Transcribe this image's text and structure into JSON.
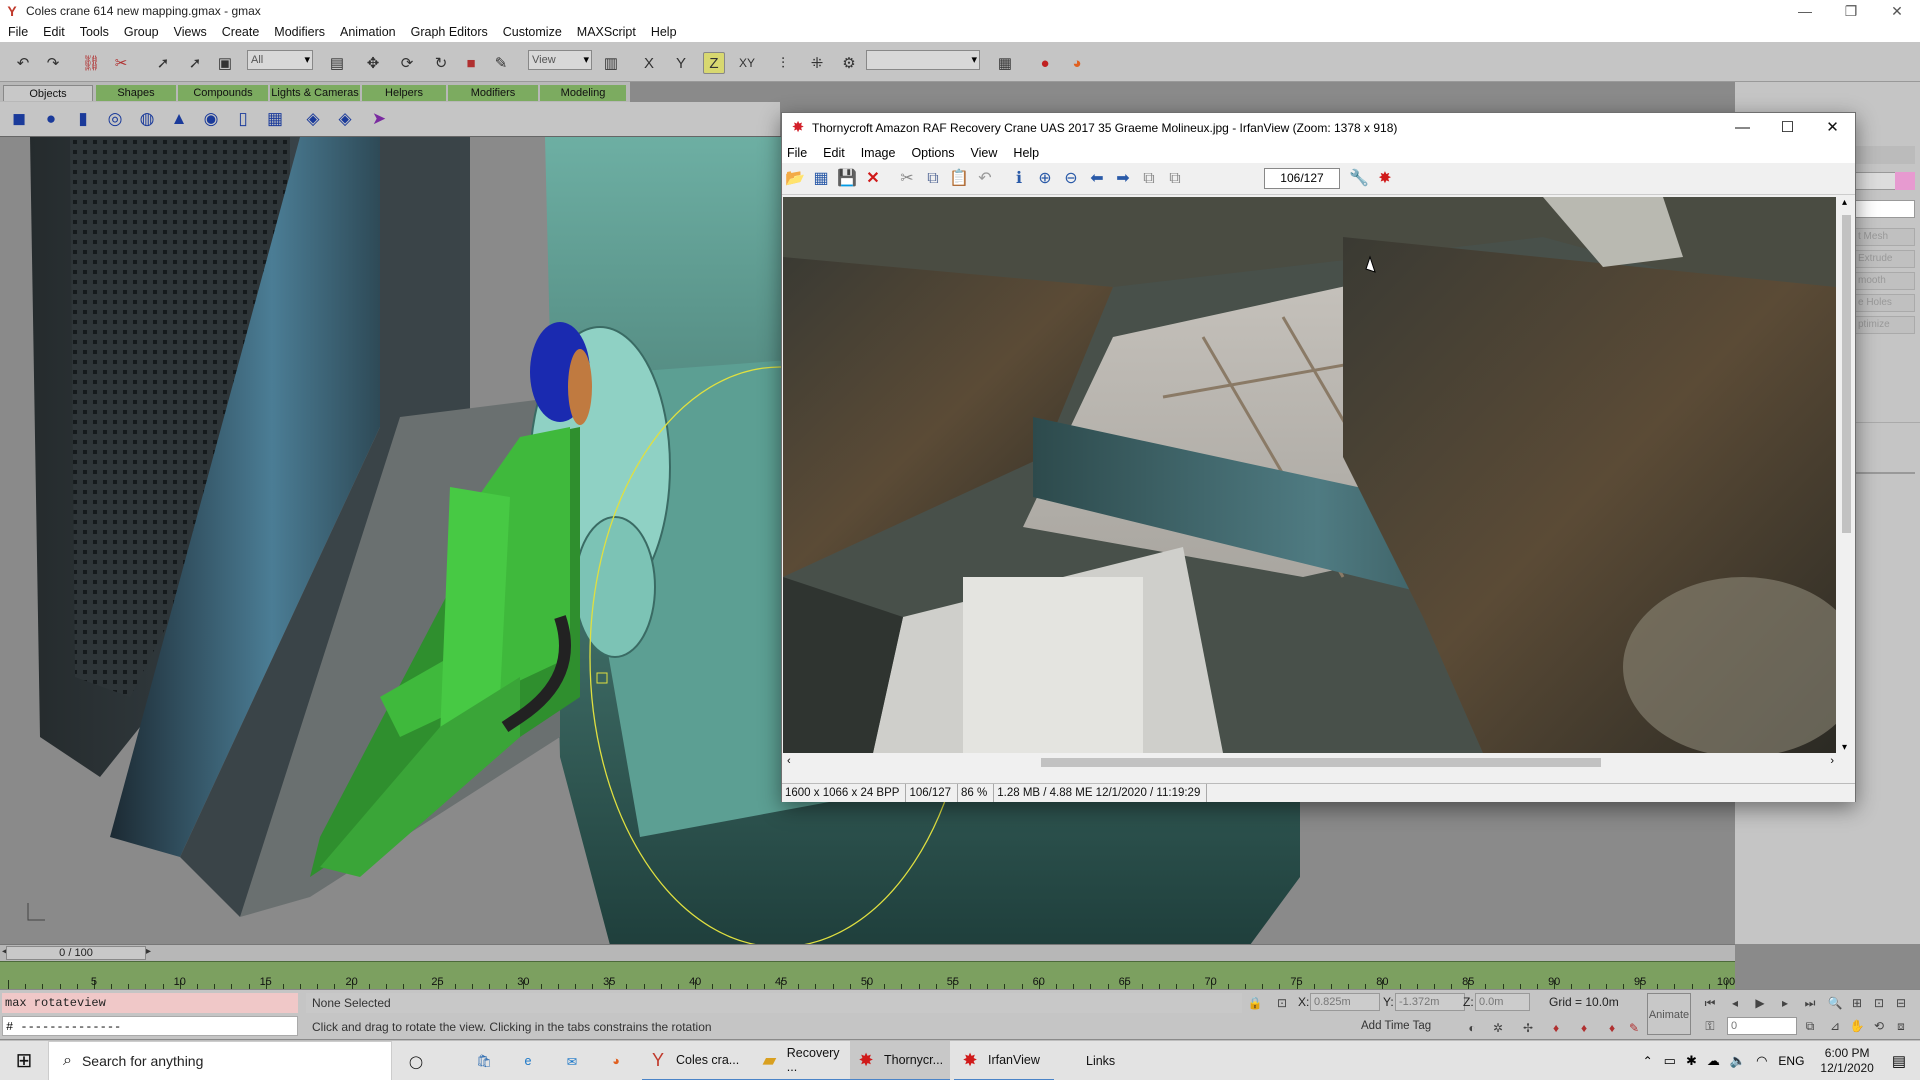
{
  "gmax": {
    "title": "Coles crane 614 new mapping.gmax - gmax",
    "window_buttons": [
      "—",
      "❐",
      "✕"
    ],
    "menu": [
      "File",
      "Edit",
      "Tools",
      "Group",
      "Views",
      "Create",
      "Modifiers",
      "Animation",
      "Graph Editors",
      "Customize",
      "MAXScript",
      "Help"
    ],
    "selection_filter": "All",
    "ref_coord": "View",
    "axis_labels": [
      "X",
      "Y",
      "Z",
      "XY"
    ],
    "tabs": [
      "Objects",
      "Shapes",
      "Compounds",
      "Lights & Cameras",
      "Helpers",
      "Modifiers",
      "Modeling"
    ],
    "active_tab": "Objects",
    "right_panel_buttons": [
      "t Mesh",
      "Extrude",
      "mooth",
      "e Holes",
      "ptimize"
    ],
    "time_slider": "0 / 100",
    "ruler_labels": [
      "5",
      "10",
      "15",
      "20",
      "25",
      "30",
      "35",
      "40",
      "45",
      "50",
      "55",
      "60",
      "65",
      "70",
      "75",
      "80",
      "85",
      "90",
      "95",
      "100"
    ],
    "maxscript_line1": "max rotateview",
    "maxscript_line2": "# --------------",
    "selection_status": "None Selected",
    "prompt": "Click and drag to rotate the view.  Clicking in the tabs constrains the rotation",
    "coords": {
      "x_label": "X:",
      "x": "0.825m",
      "y_label": "Y:",
      "y": "-1.372m",
      "z_label": "Z:",
      "z": "0.0m"
    },
    "grid": "Grid = 10.0m",
    "add_time_tag": "Add Time Tag",
    "animate": "Animate",
    "frame_field": "0"
  },
  "irfan": {
    "title": "Thornycroft Amazon RAF Recovery Crane UAS 2017 35 Graeme Molineux.jpg - IrfanView (Zoom: 1378 x 918)",
    "menu": [
      "File",
      "Edit",
      "Image",
      "Options",
      "View",
      "Help"
    ],
    "counter": "106/127",
    "status": [
      "1600 x 1066 x 24 BPP",
      "106/127",
      "86 %",
      "1.28 MB / 4.88 ME 12/1/2020 / 11:19:29"
    ],
    "window_buttons": [
      "—",
      "☐",
      "✕"
    ]
  },
  "taskbar": {
    "search_placeholder": "Search for anything",
    "items": [
      {
        "label": "Coles cra..."
      },
      {
        "label": "Recovery ..."
      },
      {
        "label": "Thornycr..."
      },
      {
        "label": "IrfanView"
      },
      {
        "label": "Links"
      }
    ],
    "lang": "ENG",
    "time": "6:00 PM",
    "date": "12/1/2020"
  },
  "colors": {
    "tab_green": "#7cab60",
    "teal_model": "#7fc0b2",
    "green_model": "#3fa53a"
  }
}
